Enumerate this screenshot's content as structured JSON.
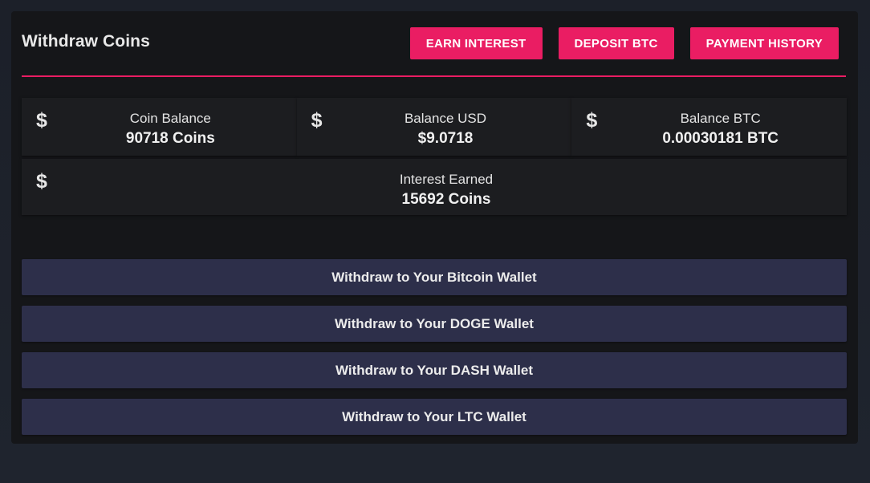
{
  "header": {
    "title": "Withdraw Coins",
    "buttons": {
      "earn_interest": "EARN INTEREST",
      "deposit_btc": "DEPOSIT BTC",
      "payment_history": "PAYMENT HISTORY"
    }
  },
  "colors": {
    "accent": "#ea1d63",
    "panel": "#151619",
    "card": "#1c1d20",
    "withdraw_button": "#2d2f4a"
  },
  "stats": [
    {
      "icon": "dollar-icon",
      "symbol": "$",
      "label": "Coin Balance",
      "value": "90718 Coins"
    },
    {
      "icon": "dollar-icon",
      "symbol": "$",
      "label": "Balance USD",
      "value": "$9.0718"
    },
    {
      "icon": "dollar-icon",
      "symbol": "$",
      "label": "Balance BTC",
      "value": "0.00030181 BTC"
    },
    {
      "icon": "dollar-icon",
      "symbol": "$",
      "label": "Interest Earned",
      "value": "15692 Coins"
    }
  ],
  "withdraw_buttons": [
    "Withdraw to Your Bitcoin Wallet",
    "Withdraw to Your DOGE Wallet",
    "Withdraw to Your DASH Wallet",
    "Withdraw to Your LTC Wallet"
  ]
}
